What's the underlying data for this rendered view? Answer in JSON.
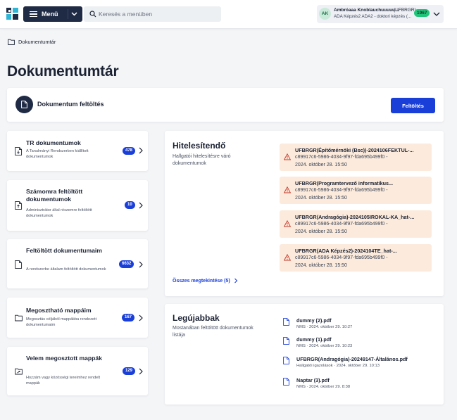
{
  "header": {
    "menu_label": "Menü",
    "search_placeholder": "Keresés a menüben",
    "user": {
      "initials": "AK",
      "name": "Ambróaaa Knoblauchuuuuu...",
      "code": "(UFBRGR)",
      "role": "ADA Képzés2 ADA2 - doktori képzés (...",
      "badge": "1967"
    }
  },
  "breadcrumb": {
    "label": "Dokumentumtár"
  },
  "page_title": "Dokumentumtár",
  "upload": {
    "title": "Dokumentum feltöltés",
    "button_label": "Feltöltés"
  },
  "nav_cards": [
    {
      "title": "TR dokumentumok",
      "desc": "A Tanulmányi Rendszerben kiállított dokumentumok",
      "badge": "478"
    },
    {
      "title": "Számomra feltöltött dokumentumok",
      "desc": "Adminisztrátor által részemre feltöltött dokumentumok",
      "badge": "10"
    },
    {
      "title": "Feltöltött dokumentumaim",
      "desc": "A rendszerbe általam feltöltött dokumentumok",
      "badge": "6632"
    },
    {
      "title": "Megosztható mappáim",
      "desc": "Megosztás céljából mappákba rendezett dokumentumaim",
      "badge": "167"
    },
    {
      "title": "Velem megosztott mappák",
      "desc": "Hozzám vagy közösségi tereimhez rendelt mappák",
      "badge": "129"
    }
  ],
  "auth": {
    "title": "Hitelesítendő",
    "desc": "Hallgatói hitelesítésre váró dokumentumok",
    "items": [
      {
        "title": "UFBRGR(Építőmérnöki (Bsc))-2024106FEKTUL-...",
        "id": "c89917c6-5986-4034-9f97-fda695b499f0 -",
        "date": "2024. október 28. 15:50"
      },
      {
        "title": "UFBRGR(Programtervező informatikus...",
        "id": "c89917c6-5986-4034-9f97-fda695b499f0 -",
        "date": "2024. október 28. 15:50"
      },
      {
        "title": "UFBRGR(Andragógia)-2024105IROKAL-KA_hat-...",
        "id": "c89917c6-5986-4034-9f97-fda695b499f0 -",
        "date": "2024. október 28. 15:50"
      },
      {
        "title": "UFBRGR(ADA Képzés2)-2024104TE_hat-...",
        "id": "c89917c6-5986-4034-9f97-fda695b499f0 -",
        "date": "2024. október 28. 15:50"
      }
    ],
    "all_link": "Összes megtekintése (5)"
  },
  "newest": {
    "title": "Legújabbak",
    "desc": "Mostanában feltöltött dokumentumok listája",
    "items": [
      {
        "name": "dummy (2).pdf",
        "meta": "NMS · 2024. október 29. 10:27"
      },
      {
        "name": "dummy (1).pdf",
        "meta": "NMS · 2024. október 29. 10:23"
      },
      {
        "name": "UFBRGR(Andragógia)-20249147-Általános.pdf",
        "meta": "Hallgatói igazolások · 2024. október 29. 10:13"
      },
      {
        "name": "Naptar (3).pdf",
        "meta": "NMS · 2024. október 29. 8:38"
      }
    ]
  },
  "colors": {
    "primary": "#1a3fd9",
    "nav_dark": "#1f2a44",
    "warning_bg": "#fcebdc",
    "warning_icon": "#c0392b",
    "badge_green": "#21c57a"
  },
  "icons": {
    "logo": "app-logo-icon",
    "menu": "hamburger-icon",
    "search": "search-icon",
    "folder": "folder-icon",
    "document": "document-icon",
    "warning": "warning-icon",
    "chevron": "chevron-right-icon"
  }
}
